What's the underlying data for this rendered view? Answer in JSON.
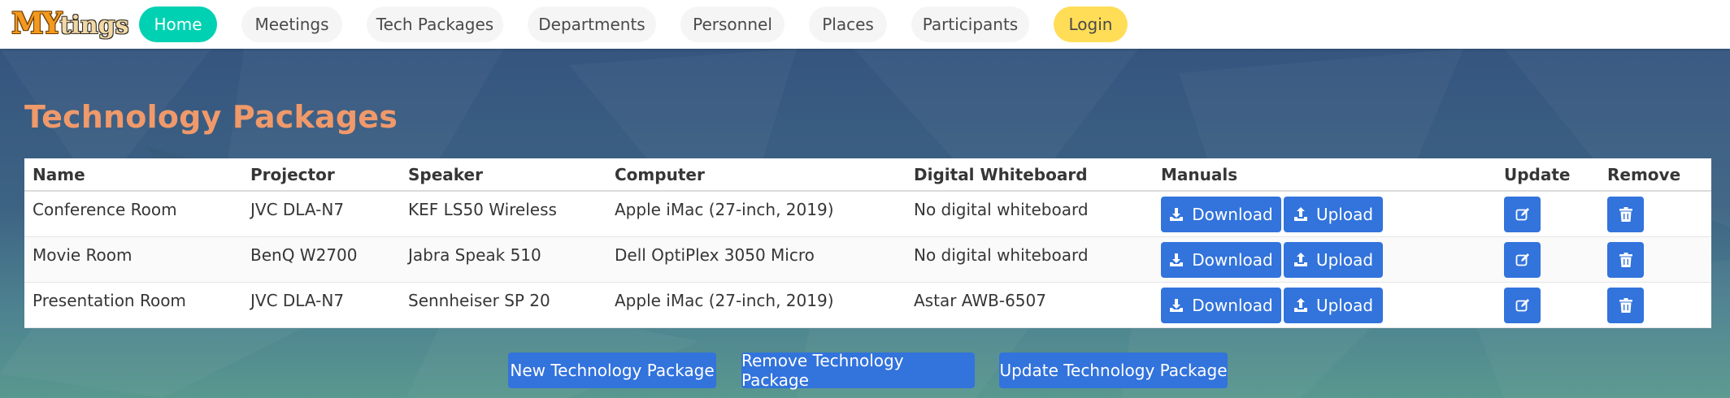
{
  "app": {
    "logo_my": "MY",
    "logo_tings": "tings"
  },
  "nav": {
    "items": [
      {
        "label": "Home"
      },
      {
        "label": "Meetings"
      },
      {
        "label": "Tech Packages"
      },
      {
        "label": "Departments"
      },
      {
        "label": "Personnel"
      },
      {
        "label": "Places"
      },
      {
        "label": "Participants"
      },
      {
        "label": "Login"
      }
    ]
  },
  "page": {
    "title": "Technology Packages"
  },
  "table": {
    "headers": [
      "Name",
      "Projector",
      "Speaker",
      "Computer",
      "Digital Whiteboard",
      "Manuals",
      "Update",
      "Remove"
    ],
    "rows": [
      {
        "name": "Conference Room",
        "projector": "JVC DLA-N7",
        "speaker": "KEF LS50 Wireless",
        "computer": "Apple iMac (27-inch, 2019)",
        "whiteboard": "No digital whiteboard"
      },
      {
        "name": "Movie Room",
        "projector": "BenQ W2700",
        "speaker": "Jabra Speak 510",
        "computer": "Dell OptiPlex 3050 Micro",
        "whiteboard": "No digital whiteboard"
      },
      {
        "name": "Presentation Room",
        "projector": "JVC DLA-N7",
        "speaker": "Sennheiser SP 20",
        "computer": "Apple iMac (27-inch, 2019)",
        "whiteboard": "Astar AWB-6507"
      }
    ],
    "download_label": "Download",
    "upload_label": "Upload"
  },
  "actions": {
    "new_label": "New Technology Package",
    "remove_label": "Remove Technology Package",
    "update_label": "Update Technology Package"
  },
  "colors": {
    "primary": "#3273dc",
    "active_nav": "#00d1b2",
    "login": "#ffdd57",
    "title": "#f0996a"
  },
  "icons": {
    "download": "download-icon",
    "upload": "upload-icon",
    "edit": "edit-icon",
    "trash": "trash-icon"
  }
}
